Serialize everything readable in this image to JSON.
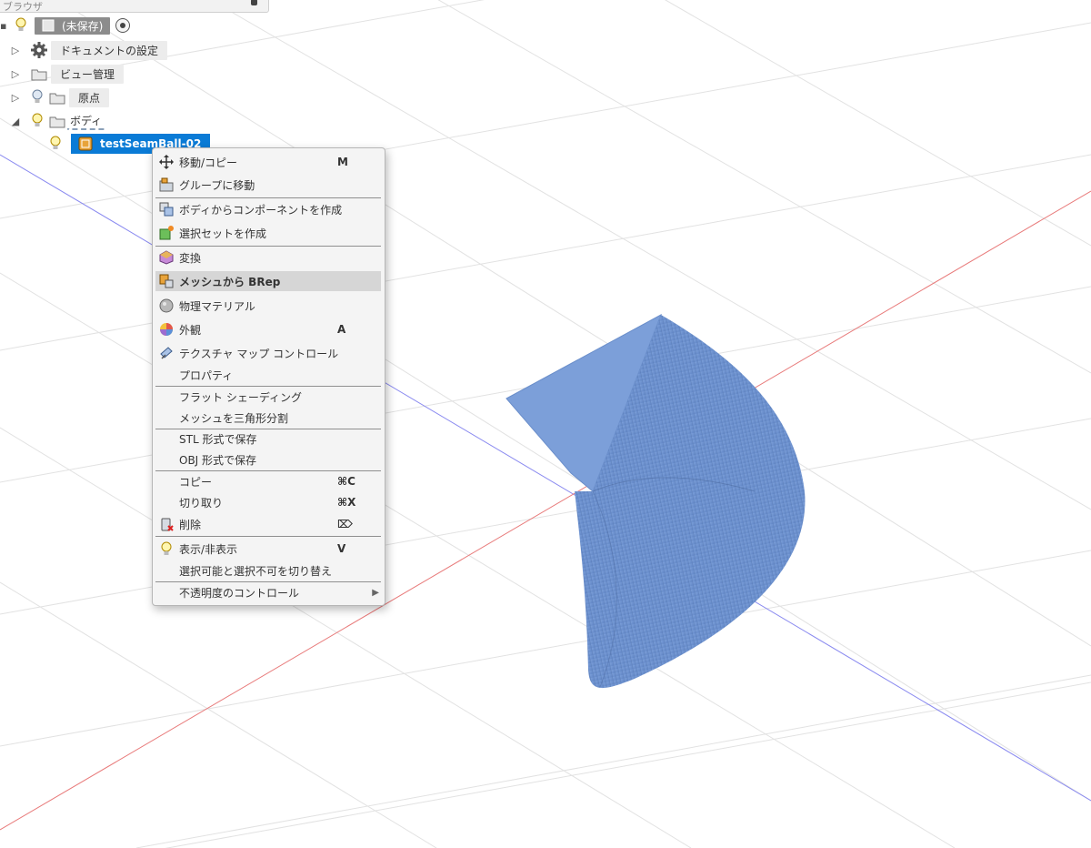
{
  "browser": {
    "header_title": "ブラウザ",
    "root_label": "(未保存)",
    "items": [
      {
        "label": "ドキュメントの設定"
      },
      {
        "label": "ビュー管理"
      },
      {
        "label": "原点"
      },
      {
        "label": "ボディ"
      }
    ],
    "selected_body": "testSeamBall-02"
  },
  "context_menu": {
    "items": [
      {
        "label": "移動/コピー",
        "shortcut": "M",
        "icon": "move-icon"
      },
      {
        "label": "グループに移動",
        "shortcut": "",
        "icon": "move-to-group-icon"
      },
      {
        "label": "ボディからコンポーネントを作成",
        "shortcut": "",
        "icon": "create-component-icon"
      },
      {
        "label": "選択セットを作成",
        "shortcut": "",
        "icon": "selection-set-icon"
      },
      {
        "label": "変換",
        "shortcut": "",
        "icon": "convert-icon"
      },
      {
        "label": "メッシュから BRep",
        "shortcut": "",
        "icon": "mesh-to-brep-icon"
      },
      {
        "label": "物理マテリアル",
        "shortcut": "",
        "icon": "physical-material-icon"
      },
      {
        "label": "外観",
        "shortcut": "A",
        "icon": "appearance-icon"
      },
      {
        "label": "テクスチャ マップ コントロール",
        "shortcut": "",
        "icon": "texture-map-icon"
      },
      {
        "label": "プロパティ",
        "shortcut": "",
        "icon": ""
      },
      {
        "label": "フラット シェーディング",
        "shortcut": "",
        "icon": ""
      },
      {
        "label": "メッシュを三角形分割",
        "shortcut": "",
        "icon": ""
      },
      {
        "label": "STL 形式で保存",
        "shortcut": "",
        "icon": ""
      },
      {
        "label": "OBJ 形式で保存",
        "shortcut": "",
        "icon": ""
      },
      {
        "label": "コピー",
        "shortcut": "⌘C",
        "icon": ""
      },
      {
        "label": "切り取り",
        "shortcut": "⌘X",
        "icon": ""
      },
      {
        "label": "削除",
        "shortcut": "⌦",
        "icon": "delete-icon"
      },
      {
        "label": "表示/非表示",
        "shortcut": "V",
        "icon": "lightbulb-icon"
      },
      {
        "label": "選択可能と選択不可を切り替え",
        "shortcut": "",
        "icon": ""
      },
      {
        "label": "不透明度のコントロール",
        "shortcut": "",
        "icon": "",
        "submenu": "▶"
      }
    ]
  },
  "colors": {
    "selection": "#0a7bd6",
    "mesh": "#6f93cf",
    "x_axis": "#e87a7a",
    "y_axis": "#8a8af0",
    "grid": "#e4e4e4"
  }
}
